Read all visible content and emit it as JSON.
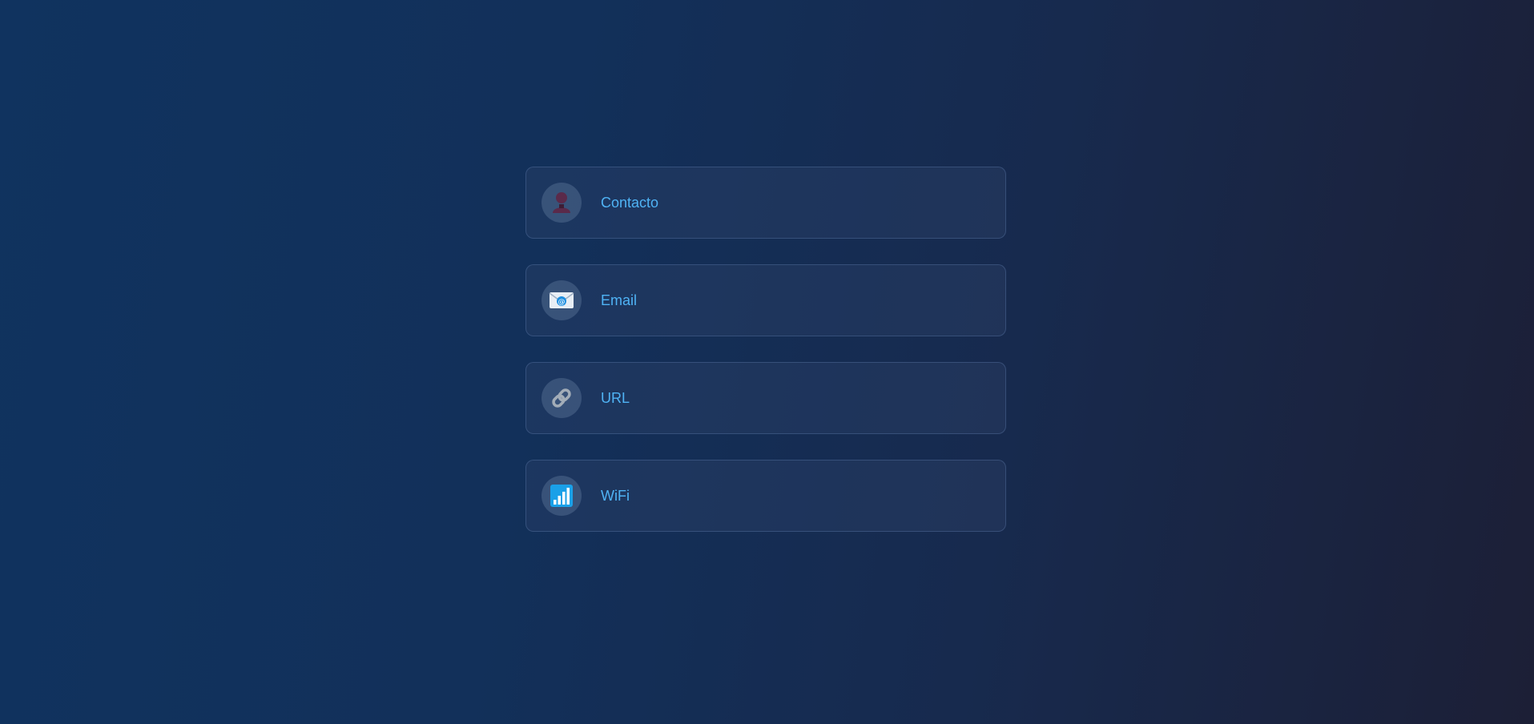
{
  "options": [
    {
      "label": "Contacto",
      "icon": "contact-icon"
    },
    {
      "label": "Email",
      "icon": "email-icon"
    },
    {
      "label": "URL",
      "icon": "link-icon"
    },
    {
      "label": "WiFi",
      "icon": "wifi-signal-icon"
    }
  ],
  "colors": {
    "label": "#4fb3f5",
    "background_start": "#10335f",
    "background_end": "#1c1f36"
  }
}
